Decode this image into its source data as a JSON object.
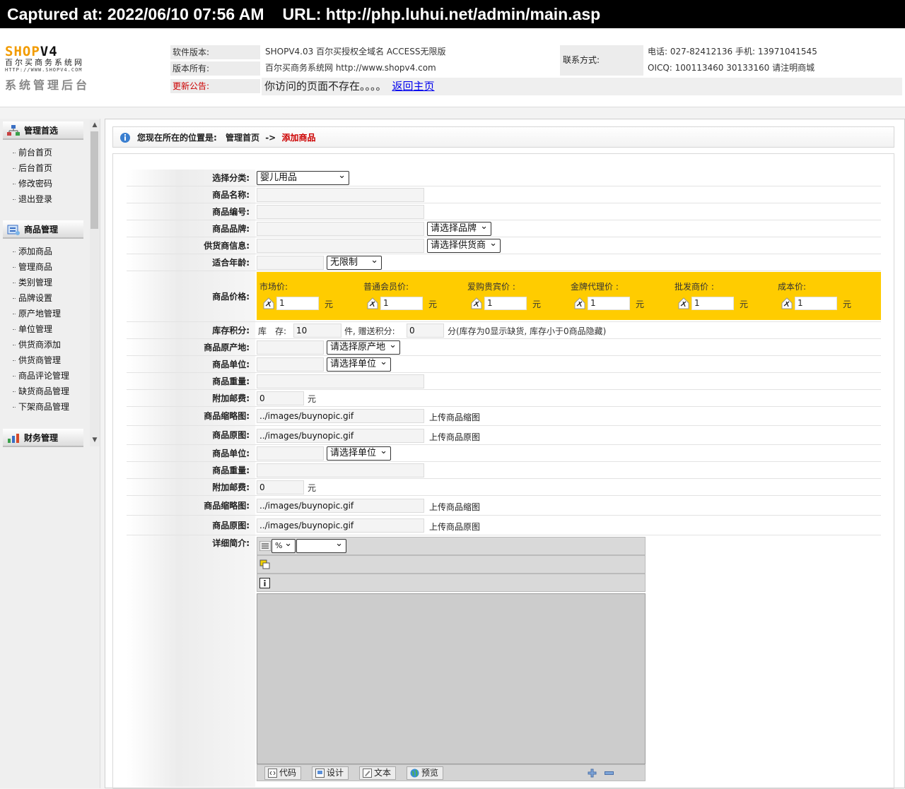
{
  "capture": {
    "captured": "Captured at: 2022/06/10 07:56 AM",
    "url": "URL: http://php.luhui.net/admin/main.asp"
  },
  "logo": {
    "main_orange": "SHOP",
    "main_black": "V4",
    "sub": "百尔买商务系统网",
    "url": "HTTP://WWW.SHOPV4.COM",
    "admin": "系统管理后台"
  },
  "header": {
    "version_label": "软件版本:",
    "version_value": "SHOPV4.03 百尔买授权全域名 ACCESS无限版",
    "owner_label": "版本所有:",
    "owner_value": "百尔买商务系统网 http://www.shopv4.com",
    "notice_label": "更新公告:",
    "notice_text": "你访问的页面不存在。。。。",
    "notice_link": "返回主页",
    "contact_label": "联系方式:",
    "contact_phone": "电话: 027-82412136 手机: 13971041545",
    "contact_qq": "OICQ: 100113460 30133160 请注明商城"
  },
  "sidebar": {
    "groups": [
      {
        "title": "管理首选",
        "items": [
          "前台首页",
          "后台首页",
          "修改密码",
          "退出登录"
        ]
      },
      {
        "title": "商品管理",
        "items": [
          "添加商品",
          "管理商品",
          "类别管理",
          "品牌设置",
          "原产地管理",
          "单位管理",
          "供货商添加",
          "供货商管理",
          "商品评论管理",
          "缺货商品管理",
          "下架商品管理"
        ]
      },
      {
        "title": "财务管理",
        "items": []
      }
    ]
  },
  "breadcrumb": {
    "prefix": "您现在所在的位置是:",
    "home": "管理首页",
    "sep": "->",
    "current": "添加商品"
  },
  "form": {
    "category_label": "选择分类:",
    "category_value": "婴儿用品",
    "name_label": "商品名称:",
    "code_label": "商品编号:",
    "brand_label": "商品品牌:",
    "brand_select": "请选择品牌",
    "supplier_label": "供货商信息:",
    "supplier_select": "请选择供货商",
    "age_label": "适合年龄:",
    "age_select": "无限制",
    "price_label": "商品价格:",
    "prices": [
      {
        "label": "市场价:",
        "value": "1",
        "unit": "元"
      },
      {
        "label": "普通会员价:",
        "value": "1",
        "unit": "元"
      },
      {
        "label": "爱购贵宾价 :",
        "value": "1",
        "unit": "元"
      },
      {
        "label": "金牌代理价 :",
        "value": "1",
        "unit": "元"
      },
      {
        "label": "批发商价 :",
        "value": "1",
        "unit": "元"
      },
      {
        "label": "成本价:",
        "value": "1",
        "unit": "元"
      }
    ],
    "stock_label": "库存积分:",
    "stock_prefix": "库　存:",
    "stock_value": "10",
    "stock_mid": "件, 赠送积分:",
    "points_value": "0",
    "stock_note": "分(库存为0显示缺货, 库存小于0商品隐藏)",
    "origin_label": "商品原产地:",
    "origin_select": "请选择原产地",
    "unit_label": "商品单位:",
    "unit_select": "请选择单位",
    "weight_label": "商品重量:",
    "postage_label": "附加邮费:",
    "postage_value": "0",
    "postage_unit": "元",
    "thumb_label": "商品缩略图:",
    "thumb_value": "../images/buynopic.gif",
    "thumb_upload": "上传商品缩图",
    "orig_label": "商品原图:",
    "orig_value": "../images/buynopic.gif",
    "orig_upload": "上传商品原图",
    "detail_label": "详细简介:"
  },
  "editor": {
    "zoom_value": "%",
    "tabs": [
      "代码",
      "设计",
      "文本",
      "预览"
    ]
  }
}
